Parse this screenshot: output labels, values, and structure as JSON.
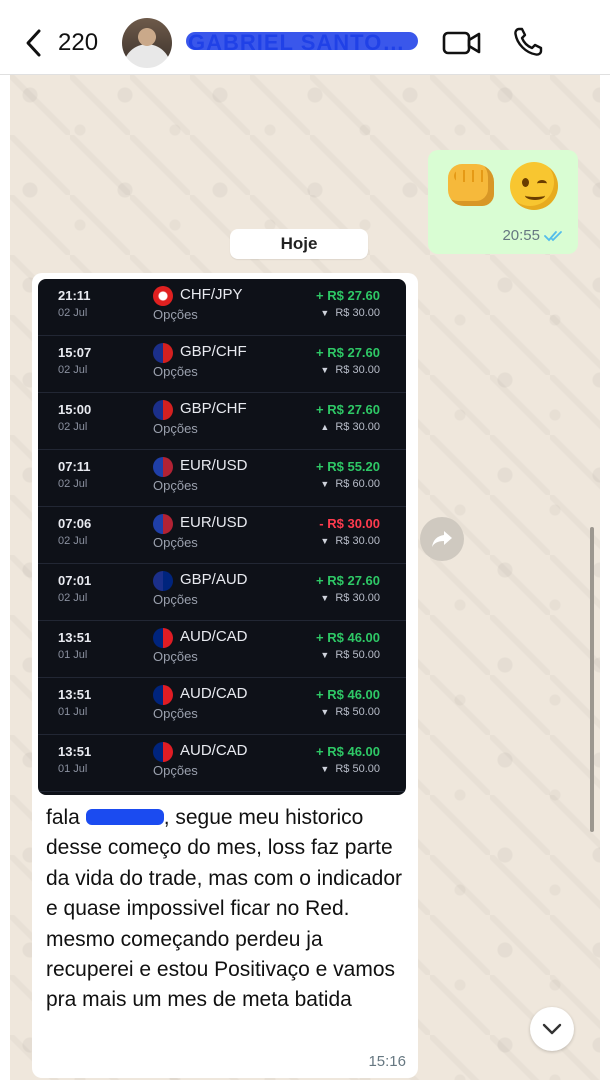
{
  "header": {
    "back_count": "220",
    "contact_name": "GABRIEL SANTOS D..."
  },
  "outgoing": {
    "emoji": [
      "oncoming-fist",
      "winking-face"
    ],
    "time": "20:55",
    "status": "read"
  },
  "date_chip": "Hoje",
  "trades": [
    {
      "time": "21:11",
      "date": "02 Jul",
      "pair": "CHF/JPY",
      "type": "Opções",
      "result": "+ R$ 27.60",
      "result_color": "#2ec866",
      "direction": "down",
      "invest": "R$ 30.00"
    },
    {
      "time": "15:07",
      "date": "02 Jul",
      "pair": "GBP/CHF",
      "type": "Opções",
      "result": "+ R$ 27.60",
      "result_color": "#2ec866",
      "direction": "down",
      "invest": "R$ 30.00"
    },
    {
      "time": "15:00",
      "date": "02 Jul",
      "pair": "GBP/CHF",
      "type": "Opções",
      "result": "+ R$ 27.60",
      "result_color": "#2ec866",
      "direction": "up",
      "invest": "R$ 30.00"
    },
    {
      "time": "07:11",
      "date": "02 Jul",
      "pair": "EUR/USD",
      "type": "Opções",
      "result": "+ R$ 55.20",
      "result_color": "#2ec866",
      "direction": "down",
      "invest": "R$ 60.00"
    },
    {
      "time": "07:06",
      "date": "02 Jul",
      "pair": "EUR/USD",
      "type": "Opções",
      "result": "- R$ 30.00",
      "result_color": "#ff3b4e",
      "direction": "down",
      "invest": "R$ 30.00"
    },
    {
      "time": "07:01",
      "date": "02 Jul",
      "pair": "GBP/AUD",
      "type": "Opções",
      "result": "+ R$ 27.60",
      "result_color": "#2ec866",
      "direction": "down",
      "invest": "R$ 30.00"
    },
    {
      "time": "13:51",
      "date": "01 Jul",
      "pair": "AUD/CAD",
      "type": "Opções",
      "result": "+ R$ 46.00",
      "result_color": "#2ec866",
      "direction": "down",
      "invest": "R$ 50.00"
    },
    {
      "time": "13:51",
      "date": "01 Jul",
      "pair": "AUD/CAD",
      "type": "Opções",
      "result": "+ R$ 46.00",
      "result_color": "#2ec866",
      "direction": "down",
      "invest": "R$ 50.00"
    },
    {
      "time": "13:51",
      "date": "01 Jul",
      "pair": "AUD/CAD",
      "type": "Opções",
      "result": "+ R$ 46.00",
      "result_color": "#2ec866",
      "direction": "down",
      "invest": "R$ 50.00"
    }
  ],
  "incoming": {
    "greeting": "fala",
    "text_after_redaction": ", segue meu historico desse começo do mes, loss faz parte da vida do trade, mas com o indicador e quase impossivel ficar no Red. mesmo começando perdeu ja recuperei e estou Positivaço e vamos pra mais um mes de meta batida",
    "time": "15:16"
  }
}
